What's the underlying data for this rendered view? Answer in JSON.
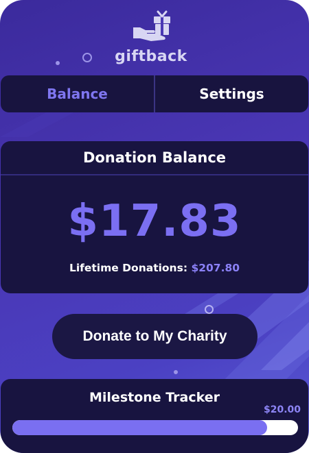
{
  "app": {
    "name": "giftback"
  },
  "tabs": [
    {
      "label": "Balance",
      "active": true
    },
    {
      "label": "Settings",
      "active": false
    }
  ],
  "balance": {
    "title": "Donation Balance",
    "amount": "$17.83",
    "lifetime_label": "Lifetime Donations:",
    "lifetime_value": "$207.80"
  },
  "donate_button": {
    "label": "Donate to My Charity"
  },
  "milestone": {
    "title": "Milestone Tracker",
    "goal_label": "$20.00",
    "progress_fraction": 0.8915
  },
  "colors": {
    "accent": "#7b6ff2",
    "card": "#181440",
    "background_start": "#3b2a9c",
    "background_end": "#5a5cd6",
    "text": "#ffffff"
  },
  "icons": {
    "logo": "gift-hand-icon"
  }
}
